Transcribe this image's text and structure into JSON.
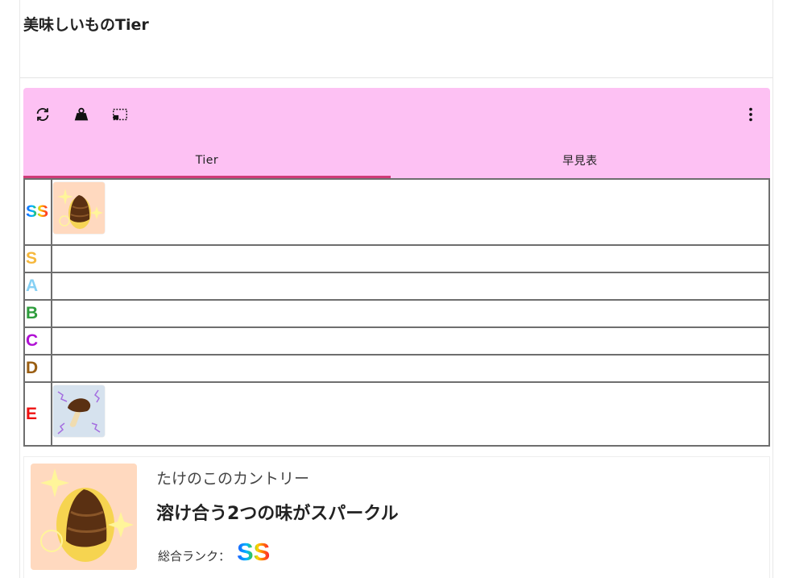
{
  "page": {
    "title": "美味しいものTier"
  },
  "toolbar": {
    "background": "#fdc1f3",
    "buttons": [
      {
        "name": "refresh-icon"
      },
      {
        "name": "weight-icon"
      },
      {
        "name": "screenshot-icon"
      }
    ],
    "more_icon": "more-vert-icon",
    "tabs": [
      {
        "label": "Tier",
        "active": true
      },
      {
        "label": "早見表",
        "active": false
      }
    ],
    "tab_indicator_color": "#d03a78"
  },
  "tiers": [
    {
      "label": "SS",
      "color": "rainbow",
      "items": [
        "takenoko"
      ]
    },
    {
      "label": "S",
      "color": "#f6b83c",
      "items": []
    },
    {
      "label": "A",
      "color": "#86d0f4",
      "items": []
    },
    {
      "label": "B",
      "color": "#2e9d3c",
      "items": []
    },
    {
      "label": "C",
      "color": "#b010d4",
      "items": []
    },
    {
      "label": "D",
      "color": "#9a5e12",
      "items": []
    },
    {
      "label": "E",
      "color": "#ee1111",
      "items": [
        "kinoko"
      ]
    }
  ],
  "detail": {
    "brand": "たけのこのカントリー",
    "name": "溶け合う2つの味がスパークル",
    "rank_label": "総合ランク：",
    "rank_value": "SS"
  }
}
